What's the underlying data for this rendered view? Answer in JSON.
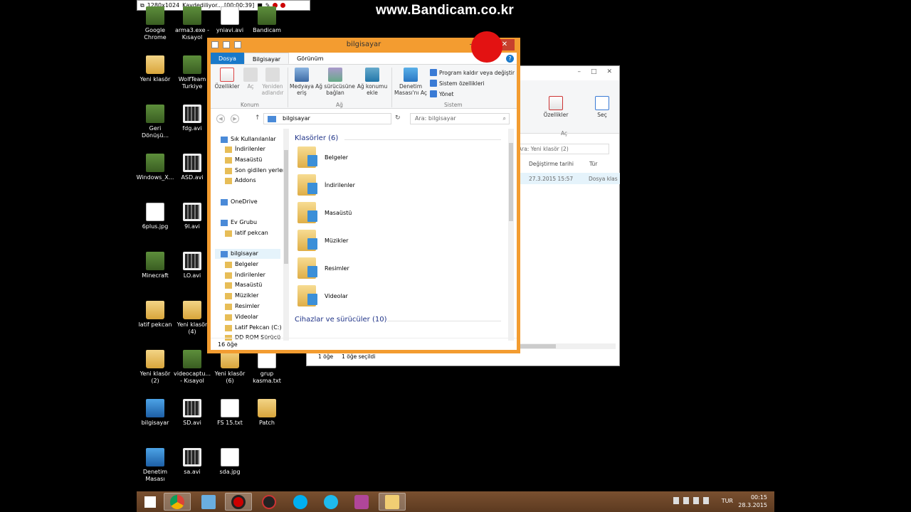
{
  "recorder": {
    "resolution": "1280x1024",
    "status": "Kaydediliyor... [00:00:39]",
    "watermark": "www.Bandicam.co.kr"
  },
  "desktop_icons": [
    {
      "label": "Google Chrome",
      "kind": "app"
    },
    {
      "label": "arma3.exe - Kısayol",
      "kind": "app"
    },
    {
      "label": "yniavi.avi",
      "kind": "file"
    },
    {
      "label": "Bandicam",
      "kind": "app"
    },
    {
      "label": "Yeni klasör",
      "kind": "folder"
    },
    {
      "label": "WolfTeam Turkiye",
      "kind": "app"
    },
    {
      "label": "Geri Dönüşü...",
      "kind": "app"
    },
    {
      "label": "fdg.avi",
      "kind": "video"
    },
    {
      "label": "Windows_X...",
      "kind": "app"
    },
    {
      "label": "ASD.avi",
      "kind": "video"
    },
    {
      "label": "6plus.jpg",
      "kind": "file"
    },
    {
      "label": "9l.avi",
      "kind": "video"
    },
    {
      "label": "Minecraft",
      "kind": "app"
    },
    {
      "label": "LO.avi",
      "kind": "video"
    },
    {
      "label": "latif pekcan",
      "kind": "folder"
    },
    {
      "label": "Yeni klasör (4)",
      "kind": "folder"
    },
    {
      "label": "Yeni klasör (2)",
      "kind": "folder"
    },
    {
      "label": "videocaptu... - Kısayol",
      "kind": "app"
    },
    {
      "label": "Yeni klasör (6)",
      "kind": "folder"
    },
    {
      "label": "grup kasma.txt",
      "kind": "file"
    },
    {
      "label": "bilgisayar",
      "kind": "pc"
    },
    {
      "label": "SD.avi",
      "kind": "video"
    },
    {
      "label": "FS 15.txt",
      "kind": "file"
    },
    {
      "label": "Patch",
      "kind": "folder"
    },
    {
      "label": "Denetim Masası",
      "kind": "pc"
    },
    {
      "label": "sa.avi",
      "kind": "video"
    },
    {
      "label": "sda.jpg",
      "kind": "file"
    }
  ],
  "explorer": {
    "title": "bilgisayar",
    "tabs": [
      "Dosya",
      "Bilgisayar",
      "Görünüm"
    ],
    "ribbon": {
      "ozellikler": "Özellikler",
      "ac": "Aç",
      "yeniden_adlandir": "Yeniden adlandır",
      "konum": "Konum",
      "medyaya_eris": "Medyaya eriş",
      "ag_surucusune_bagla": "Ağ sürücüsüne bağlan",
      "ag_konumu_ekle": "Ağ konumu ekle",
      "ag": "Ağ",
      "denetim_masasi": "Denetim Masası'nı Aç",
      "program_kaldir": "Program kaldır veya değiştir",
      "sistem_ozellikleri": "Sistem özellikleri",
      "yonet": "Yönet",
      "sistem": "Sistem"
    },
    "address": "bilgisayar",
    "search_placeholder": "Ara: bilgisayar",
    "nav": [
      {
        "label": "Sık Kullanılanlar",
        "indent": 0
      },
      {
        "label": "İndirilenler",
        "indent": 1
      },
      {
        "label": "Masaüstü",
        "indent": 1
      },
      {
        "label": "Son gidilen yerler",
        "indent": 1
      },
      {
        "label": "Addons",
        "indent": 1
      },
      {
        "label": "OneDrive",
        "indent": 0
      },
      {
        "label": "Ev Grubu",
        "indent": 0
      },
      {
        "label": "latif pekcan",
        "indent": 1
      },
      {
        "label": "bilgisayar",
        "indent": 0
      },
      {
        "label": "Belgeler",
        "indent": 1
      },
      {
        "label": "İndirilenler",
        "indent": 1
      },
      {
        "label": "Masaüstü",
        "indent": 1
      },
      {
        "label": "Müzikler",
        "indent": 1
      },
      {
        "label": "Resimler",
        "indent": 1
      },
      {
        "label": "Videolar",
        "indent": 1
      },
      {
        "label": "Latif Pekcan (C:)",
        "indent": 1
      },
      {
        "label": "DD ROM Sürücü",
        "indent": 1
      }
    ],
    "group_folders": "Klasörler (6)",
    "folders": [
      "Belgeler",
      "İndirilenler",
      "Masaüstü",
      "Müzikler",
      "Resimler",
      "Videolar"
    ],
    "group_devices": "Cihazlar ve sürücüler (10)",
    "status": "16 öğe"
  },
  "background_window": {
    "ozellikler": "Özellikler",
    "sec": "Seç",
    "ac": "Aç",
    "search_placeholder": "Ara: Yeni klasör (2)",
    "col_date": "Değiştirme tarihi",
    "col_type": "Tür",
    "row_date": "27.3.2015 15:57",
    "row_type": "Dosya klas",
    "status_items": "1 öğe",
    "status_selected": "1 öğe seçildi"
  },
  "taskbar": {
    "lang": "TUR",
    "time": "00:15",
    "date": "28.3.2015"
  },
  "colors": {
    "window_border": "#f39c30",
    "file_tab": "#1979ca",
    "taskbar": "#6b4428",
    "record_dot": "#e31212"
  }
}
